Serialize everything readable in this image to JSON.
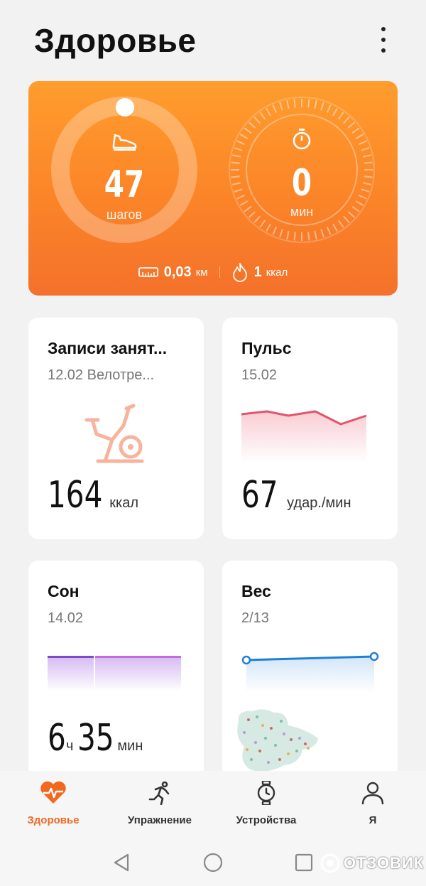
{
  "header": {
    "title": "Здоровье",
    "menu_icon": "more-vert-icon"
  },
  "activity": {
    "steps": {
      "value": "47",
      "unit": "шагов",
      "icon": "shoe-icon",
      "goal_progress": 0.005
    },
    "duration": {
      "value": "0",
      "unit": "мин",
      "icon": "stopwatch-icon"
    },
    "distance": {
      "value": "0,03",
      "unit": "км",
      "icon": "ruler-icon"
    },
    "calories": {
      "value": "1",
      "unit": "ккал",
      "icon": "flame-icon"
    },
    "colors": {
      "start": "#ff9d2e",
      "end": "#f4712b"
    }
  },
  "cards": {
    "workouts": {
      "title": "Записи занят...",
      "subtitle": "12.02 Велотре...",
      "value": "164",
      "unit": "ккал",
      "icon": "exercise-bike-icon"
    },
    "pulse": {
      "title": "Пульс",
      "subtitle": "15.02",
      "value": "67",
      "unit": "удар./мин",
      "color": "#e0566a"
    },
    "sleep": {
      "title": "Сон",
      "subtitle": "14.02",
      "hours": "6",
      "hours_unit": "ч",
      "minutes": "35",
      "minutes_unit": "мин",
      "color": "#a86ad8"
    },
    "weight": {
      "title": "Вес",
      "subtitle": "2/13",
      "color": "#1e7fd6"
    }
  },
  "tabs": [
    {
      "label": "Здоровье",
      "icon": "heart-pulse-icon",
      "active": true
    },
    {
      "label": "Упражнение",
      "icon": "running-person-icon",
      "active": false
    },
    {
      "label": "Устройства",
      "icon": "watch-icon",
      "active": false
    },
    {
      "label": "Я",
      "icon": "person-icon",
      "active": false
    }
  ],
  "system_nav": [
    "back-icon",
    "home-icon",
    "recents-icon"
  ],
  "watermark": {
    "text": "ОТЗОВИК"
  },
  "accent": "#f0691f"
}
